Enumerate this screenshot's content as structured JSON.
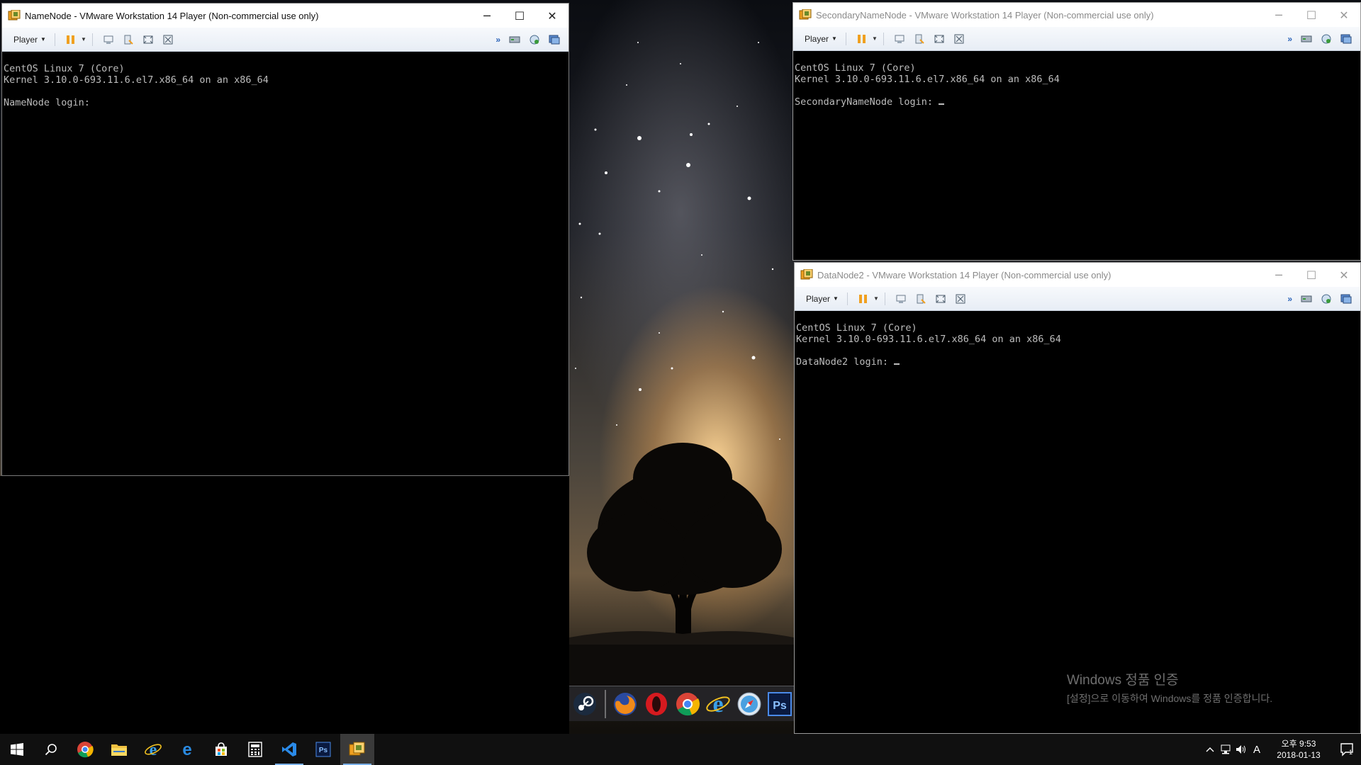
{
  "windows": {
    "namenode": {
      "title": "NameNode - VMware Workstation 14 Player (Non-commercial use only)",
      "player_label": "Player",
      "console": {
        "line1": "CentOS Linux 7 (Core)",
        "line2": "Kernel 3.10.0-693.11.6.el7.x86_64 on an x86_64",
        "login": "NameNode login: "
      }
    },
    "secondary": {
      "title": "SecondaryNameNode - VMware Workstation 14 Player (Non-commercial use only)",
      "player_label": "Player",
      "console": {
        "line1": "CentOS Linux 7 (Core)",
        "line2": "Kernel 3.10.0-693.11.6.el7.x86_64 on an x86_64",
        "login": "SecondaryNameNode login: "
      }
    },
    "datanode2": {
      "title": "DataNode2 - VMware Workstation 14 Player (Non-commercial use only)",
      "player_label": "Player",
      "console": {
        "line1": "CentOS Linux 7 (Core)",
        "line2": "Kernel 3.10.0-693.11.6.el7.x86_64 on an x86_64",
        "login": "DataNode2 login: "
      }
    }
  },
  "window_controls": {
    "minimize": "─",
    "maximize": "☐",
    "close": "✕"
  },
  "dock": {
    "items": [
      "steam-icon",
      "firefox-icon",
      "opera-icon",
      "chrome-icon",
      "ie-icon",
      "safari-icon",
      "photoshop-icon"
    ],
    "ps_label": "Ps"
  },
  "activation": {
    "title": "Windows 정품 인증",
    "message": "[설정]으로 이동하여 Windows를 정품 인증합니다."
  },
  "taskbar": {
    "pinned": [
      "windows-start-icon",
      "search-icon",
      "chrome-icon",
      "file-explorer-icon",
      "ie-icon",
      "edge-icon",
      "store-icon",
      "calculator-icon",
      "vscode-icon",
      "photoshop-icon",
      "vmware-icon"
    ],
    "ps_label": "Ps",
    "ime_label": "A",
    "time": "오후 9:53",
    "date": "2018-01-13",
    "notification_count": "1"
  },
  "colors": {
    "console_text": "#bdbdbd",
    "toolbar_bg": "#e7edf5",
    "taskbar_bg": "#101010",
    "vmware_orange": "#f0a020"
  }
}
